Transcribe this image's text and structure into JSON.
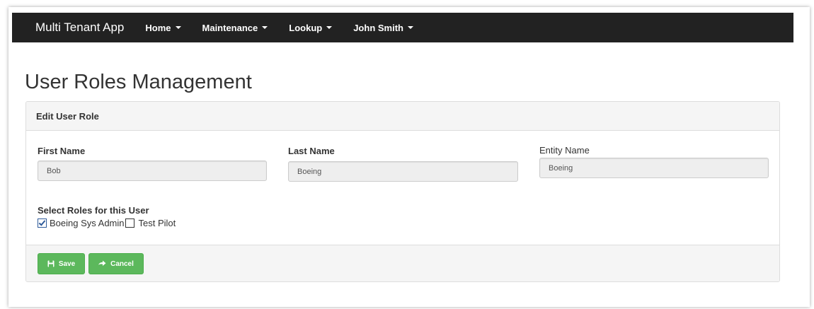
{
  "navbar": {
    "brand": "Multi Tenant App",
    "items": [
      {
        "label": "Home"
      },
      {
        "label": "Maintenance"
      },
      {
        "label": "Lookup"
      },
      {
        "label": "John Smith"
      }
    ]
  },
  "page": {
    "title": "User Roles Management"
  },
  "panel": {
    "heading": "Edit User Role",
    "fields": {
      "first_name": {
        "label": "First Name",
        "value": "Bob"
      },
      "last_name": {
        "label": "Last Name",
        "value": "Boeing"
      },
      "entity_name": {
        "label": "Entity Name",
        "value": "Boeing"
      }
    },
    "roles": {
      "label": "Select Roles for this User",
      "options": [
        {
          "label": "Boeing Sys Admin",
          "checked": true
        },
        {
          "label": "Test Pilot",
          "checked": false
        }
      ]
    },
    "buttons": {
      "save": "Save",
      "cancel": "Cancel"
    }
  },
  "colors": {
    "navbar_bg": "#222222",
    "button_success": "#5cb85c",
    "checkbox_accent": "#2f5b9a"
  }
}
